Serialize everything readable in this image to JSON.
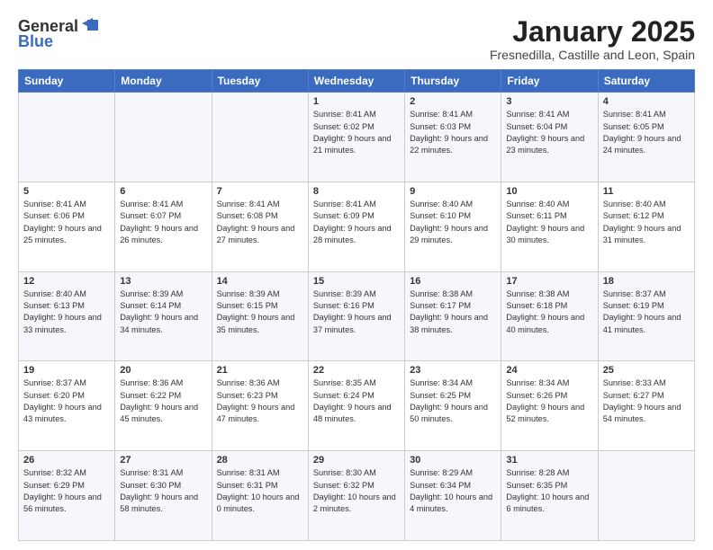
{
  "logo": {
    "general": "General",
    "blue": "Blue"
  },
  "header": {
    "title": "January 2025",
    "location": "Fresnedilla, Castille and Leon, Spain"
  },
  "days_of_week": [
    "Sunday",
    "Monday",
    "Tuesday",
    "Wednesday",
    "Thursday",
    "Friday",
    "Saturday"
  ],
  "weeks": [
    [
      {
        "day": "",
        "info": ""
      },
      {
        "day": "",
        "info": ""
      },
      {
        "day": "",
        "info": ""
      },
      {
        "day": "1",
        "info": "Sunrise: 8:41 AM\nSunset: 6:02 PM\nDaylight: 9 hours and 21 minutes."
      },
      {
        "day": "2",
        "info": "Sunrise: 8:41 AM\nSunset: 6:03 PM\nDaylight: 9 hours and 22 minutes."
      },
      {
        "day": "3",
        "info": "Sunrise: 8:41 AM\nSunset: 6:04 PM\nDaylight: 9 hours and 23 minutes."
      },
      {
        "day": "4",
        "info": "Sunrise: 8:41 AM\nSunset: 6:05 PM\nDaylight: 9 hours and 24 minutes."
      }
    ],
    [
      {
        "day": "5",
        "info": "Sunrise: 8:41 AM\nSunset: 6:06 PM\nDaylight: 9 hours and 25 minutes."
      },
      {
        "day": "6",
        "info": "Sunrise: 8:41 AM\nSunset: 6:07 PM\nDaylight: 9 hours and 26 minutes."
      },
      {
        "day": "7",
        "info": "Sunrise: 8:41 AM\nSunset: 6:08 PM\nDaylight: 9 hours and 27 minutes."
      },
      {
        "day": "8",
        "info": "Sunrise: 8:41 AM\nSunset: 6:09 PM\nDaylight: 9 hours and 28 minutes."
      },
      {
        "day": "9",
        "info": "Sunrise: 8:40 AM\nSunset: 6:10 PM\nDaylight: 9 hours and 29 minutes."
      },
      {
        "day": "10",
        "info": "Sunrise: 8:40 AM\nSunset: 6:11 PM\nDaylight: 9 hours and 30 minutes."
      },
      {
        "day": "11",
        "info": "Sunrise: 8:40 AM\nSunset: 6:12 PM\nDaylight: 9 hours and 31 minutes."
      }
    ],
    [
      {
        "day": "12",
        "info": "Sunrise: 8:40 AM\nSunset: 6:13 PM\nDaylight: 9 hours and 33 minutes."
      },
      {
        "day": "13",
        "info": "Sunrise: 8:39 AM\nSunset: 6:14 PM\nDaylight: 9 hours and 34 minutes."
      },
      {
        "day": "14",
        "info": "Sunrise: 8:39 AM\nSunset: 6:15 PM\nDaylight: 9 hours and 35 minutes."
      },
      {
        "day": "15",
        "info": "Sunrise: 8:39 AM\nSunset: 6:16 PM\nDaylight: 9 hours and 37 minutes."
      },
      {
        "day": "16",
        "info": "Sunrise: 8:38 AM\nSunset: 6:17 PM\nDaylight: 9 hours and 38 minutes."
      },
      {
        "day": "17",
        "info": "Sunrise: 8:38 AM\nSunset: 6:18 PM\nDaylight: 9 hours and 40 minutes."
      },
      {
        "day": "18",
        "info": "Sunrise: 8:37 AM\nSunset: 6:19 PM\nDaylight: 9 hours and 41 minutes."
      }
    ],
    [
      {
        "day": "19",
        "info": "Sunrise: 8:37 AM\nSunset: 6:20 PM\nDaylight: 9 hours and 43 minutes."
      },
      {
        "day": "20",
        "info": "Sunrise: 8:36 AM\nSunset: 6:22 PM\nDaylight: 9 hours and 45 minutes."
      },
      {
        "day": "21",
        "info": "Sunrise: 8:36 AM\nSunset: 6:23 PM\nDaylight: 9 hours and 47 minutes."
      },
      {
        "day": "22",
        "info": "Sunrise: 8:35 AM\nSunset: 6:24 PM\nDaylight: 9 hours and 48 minutes."
      },
      {
        "day": "23",
        "info": "Sunrise: 8:34 AM\nSunset: 6:25 PM\nDaylight: 9 hours and 50 minutes."
      },
      {
        "day": "24",
        "info": "Sunrise: 8:34 AM\nSunset: 6:26 PM\nDaylight: 9 hours and 52 minutes."
      },
      {
        "day": "25",
        "info": "Sunrise: 8:33 AM\nSunset: 6:27 PM\nDaylight: 9 hours and 54 minutes."
      }
    ],
    [
      {
        "day": "26",
        "info": "Sunrise: 8:32 AM\nSunset: 6:29 PM\nDaylight: 9 hours and 56 minutes."
      },
      {
        "day": "27",
        "info": "Sunrise: 8:31 AM\nSunset: 6:30 PM\nDaylight: 9 hours and 58 minutes."
      },
      {
        "day": "28",
        "info": "Sunrise: 8:31 AM\nSunset: 6:31 PM\nDaylight: 10 hours and 0 minutes."
      },
      {
        "day": "29",
        "info": "Sunrise: 8:30 AM\nSunset: 6:32 PM\nDaylight: 10 hours and 2 minutes."
      },
      {
        "day": "30",
        "info": "Sunrise: 8:29 AM\nSunset: 6:34 PM\nDaylight: 10 hours and 4 minutes."
      },
      {
        "day": "31",
        "info": "Sunrise: 8:28 AM\nSunset: 6:35 PM\nDaylight: 10 hours and 6 minutes."
      },
      {
        "day": "",
        "info": ""
      }
    ]
  ]
}
